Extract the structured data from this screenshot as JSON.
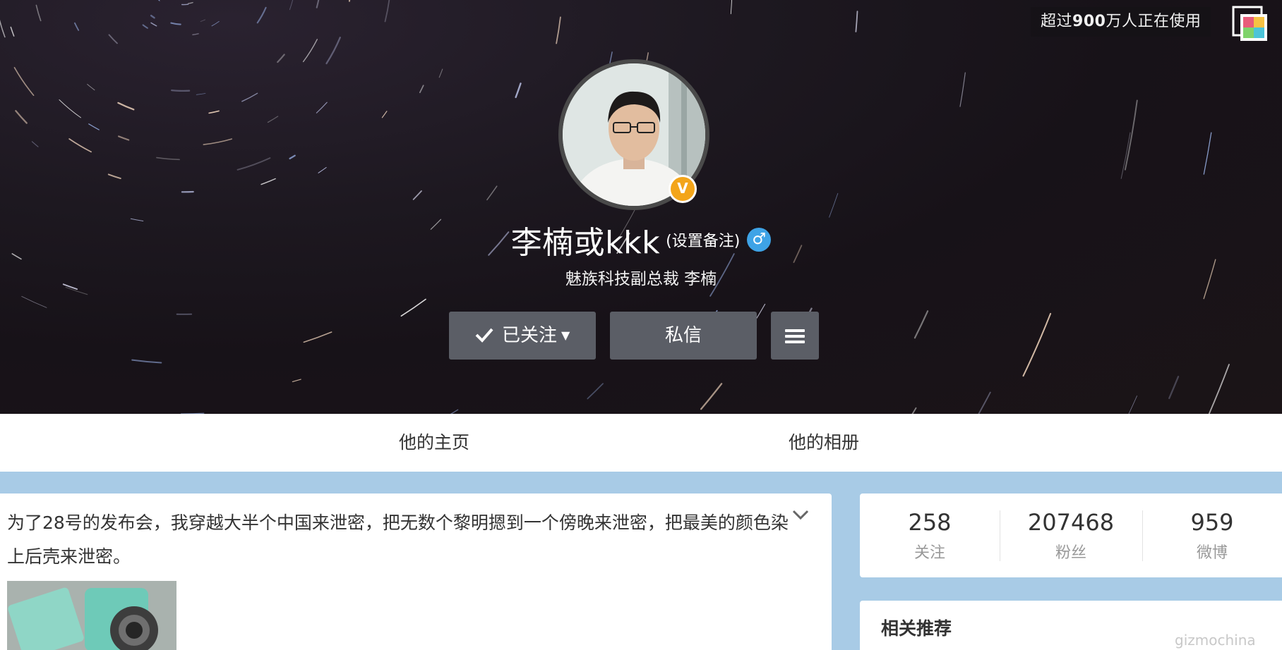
{
  "cover": {
    "users_prefix": "超过",
    "users_count": "900",
    "users_suffix": "万人正在使用"
  },
  "profile": {
    "name": "李楠或kkk",
    "remark": "(设置备注)",
    "gender_icon": "♂",
    "verified_badge": "V",
    "bio": "魅族科技副总裁 李楠"
  },
  "actions": {
    "follow_label": "已关注",
    "message_label": "私信"
  },
  "tabs": {
    "home": "他的主页",
    "album": "他的相册"
  },
  "feed": {
    "text": "为了28号的发布会，我穿越大半个中国来泄密，把无数个黎明摁到一个傍晚来泄密，把最美的颜色染上后壳来泄密。"
  },
  "stats": {
    "following_count": "258",
    "following_label": "关注",
    "fans_count": "207468",
    "fans_label": "粉丝",
    "posts_count": "959",
    "posts_label": "微博"
  },
  "recommend": {
    "title": "相关推荐"
  },
  "watermark": "gizmochina",
  "colors": {
    "button_bg": "#5b5e66",
    "page_bg": "#a8cbe6",
    "verified": "#f3a51a",
    "gender": "#3ea3e6"
  }
}
